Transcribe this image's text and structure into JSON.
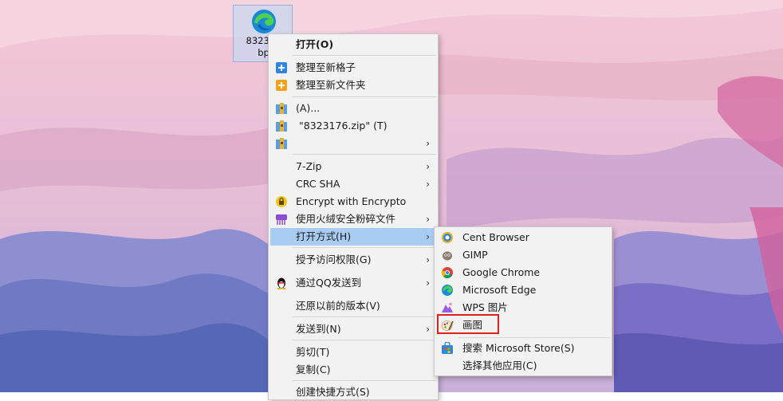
{
  "desktop": {
    "file_name_line1": "832317",
    "file_name_line2": "bp"
  },
  "context_menu": {
    "open": "打开(O)",
    "tidy_new_grid": "整理至新格子",
    "tidy_new_folder": "整理至新文件夹",
    "archive_add": "(A)...",
    "archive_zip": "\"8323176.zip\" (T)",
    "archive_more": "",
    "sevenzip": "7-Zip",
    "crc_sha": "CRC SHA",
    "encrypto": "Encrypt with Encrypto",
    "shred": "使用火绒安全粉碎文件",
    "open_with": "打开方式(H)",
    "grant_access": "授予访问权限(G)",
    "send_qq": "通过QQ发送到",
    "restore_versions": "还原以前的版本(V)",
    "send_to": "发送到(N)",
    "cut": "剪切(T)",
    "copy": "复制(C)",
    "create_shortcut": "创建快捷方式(S)"
  },
  "open_with_menu": {
    "cent_browser": "Cent Browser",
    "gimp": "GIMP",
    "google_chrome": "Google Chrome",
    "microsoft_edge": "Microsoft Edge",
    "wps_picture": "WPS 图片",
    "paint": "画图",
    "search_store": "搜索 Microsoft Store(S)",
    "choose_other": "选择其他应用(C)"
  },
  "colors": {
    "menu_bg": "#f2f2f2",
    "hover": "#a9cdf2",
    "highlight_border": "#e02020"
  }
}
